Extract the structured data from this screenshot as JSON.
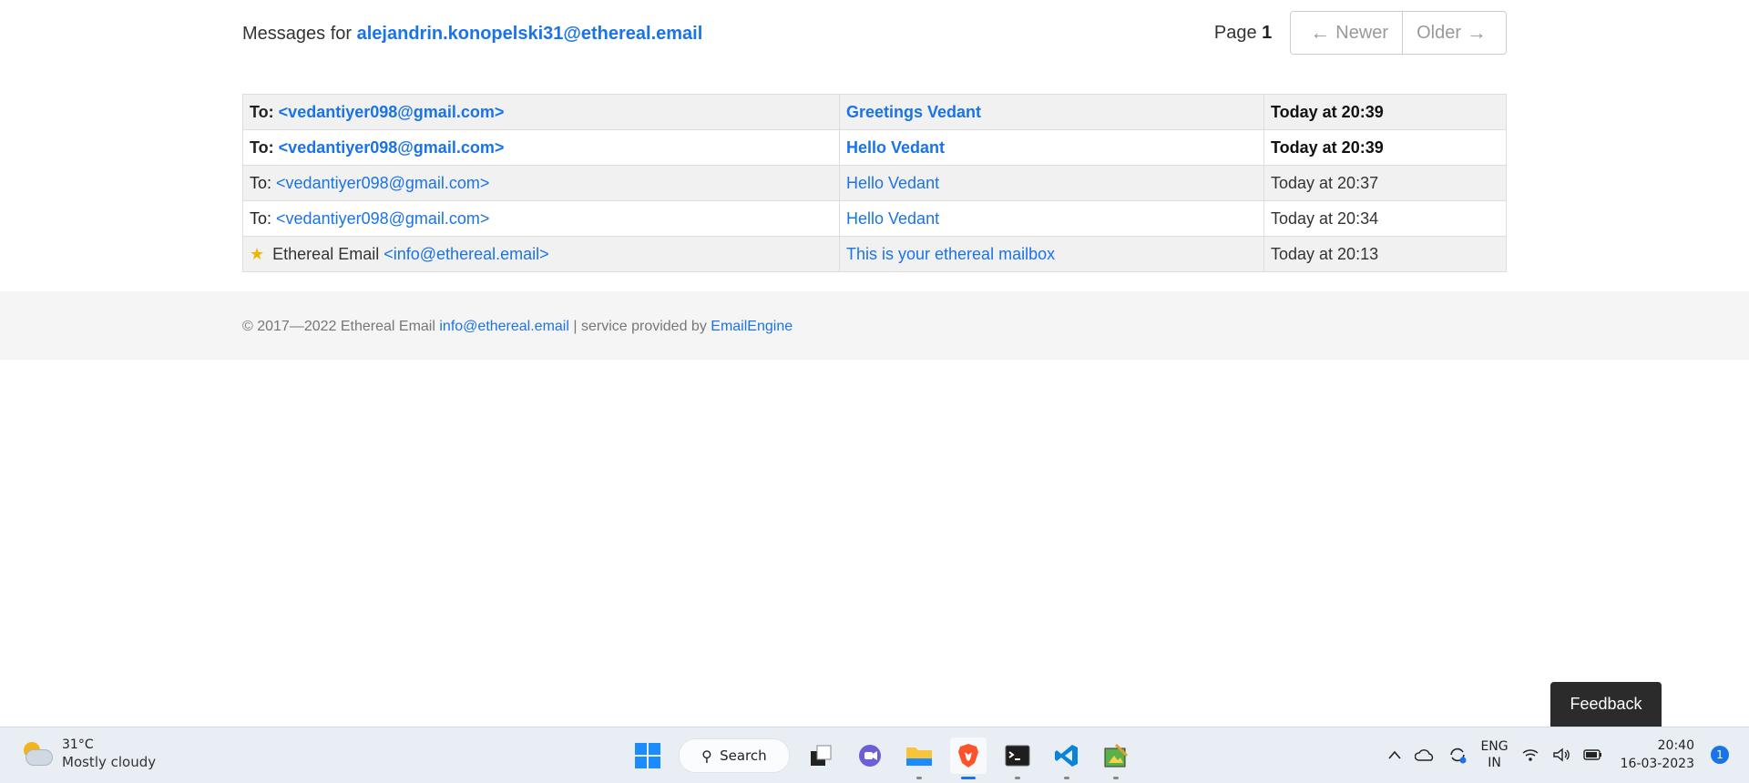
{
  "header": {
    "prefix": "Messages for",
    "mailbox": "alejandrin.konopelski31@ethereal.email",
    "page_label": "Page",
    "page_number": "1",
    "newer_label": "Newer",
    "older_label": "Older"
  },
  "messages": [
    {
      "to_label": "To:",
      "address": "<vedantiyer098@gmail.com>",
      "subject": "Greetings Vedant",
      "time": "Today at 20:39",
      "unread": true
    },
    {
      "to_label": "To:",
      "address": "<vedantiyer098@gmail.com>",
      "subject": "Hello Vedant",
      "time": "Today at 20:39",
      "unread": true
    },
    {
      "to_label": "To:",
      "address": "<vedantiyer098@gmail.com>",
      "subject": "Hello Vedant",
      "time": "Today at 20:37",
      "unread": false
    },
    {
      "to_label": "To:",
      "address": "<vedantiyer098@gmail.com>",
      "subject": "Hello Vedant",
      "time": "Today at 20:34",
      "unread": false
    },
    {
      "star": "★",
      "sender": "Ethereal Email",
      "address": "<info@ethereal.email>",
      "subject": "This is your ethereal mailbox",
      "time": "Today at 20:13",
      "unread": false
    }
  ],
  "footer": {
    "copyright": "© 2017—2022 Ethereal Email",
    "email": "info@ethereal.email",
    "separator": "| service provided by",
    "provider": "EmailEngine"
  },
  "feedback_label": "Feedback",
  "taskbar": {
    "weather_temp": "31°C",
    "weather_desc": "Mostly cloudy",
    "search_label": "Search",
    "lang_top": "ENG",
    "lang_bottom": "IN",
    "time": "20:40",
    "date": "16-03-2023",
    "notification_count": "1"
  },
  "colors": {
    "link": "#1a73e8",
    "star": "#f0b400",
    "feedback_bg": "#2b2b2b"
  }
}
